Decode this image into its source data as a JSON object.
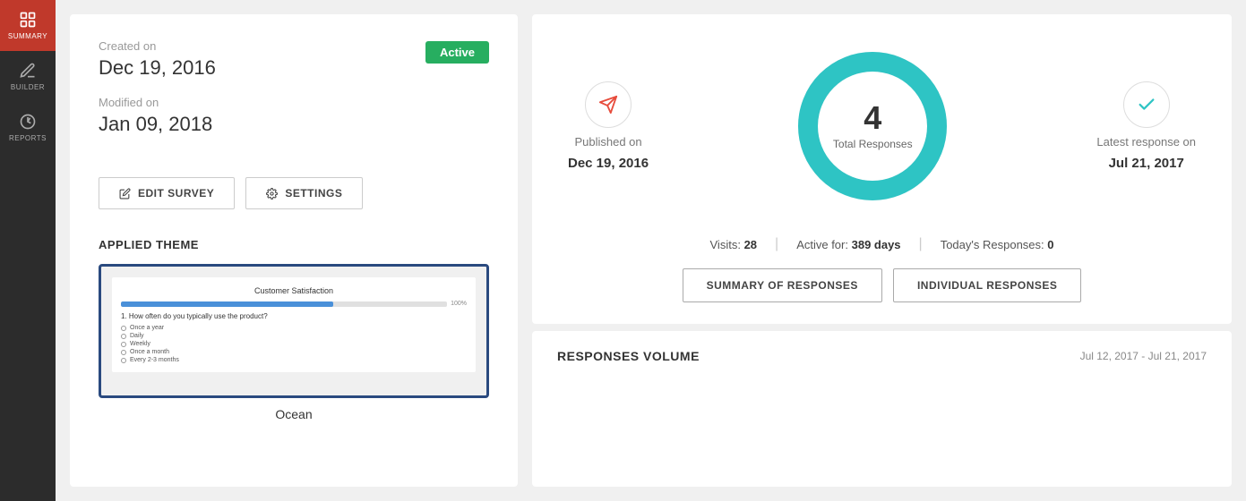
{
  "sidebar": {
    "items": [
      {
        "id": "summary",
        "label": "Summary",
        "active": true
      },
      {
        "id": "builder",
        "label": "Builder",
        "active": false
      },
      {
        "id": "reports",
        "label": "Reports",
        "active": false
      }
    ]
  },
  "left_panel": {
    "created_label": "Created on",
    "created_date": "Dec 19, 2016",
    "modified_label": "Modified on",
    "modified_date": "Jan 09, 2018",
    "status_badge": "Active",
    "edit_survey_label": "EDIT SURVEY",
    "settings_label": "SETTINGS",
    "applied_theme_label": "APPLIED THEME",
    "theme_preview_title": "Customer Satisfaction",
    "theme_name": "Ocean",
    "theme_bar_label": "100%"
  },
  "right_panel": {
    "published_label": "Published on",
    "published_date": "Dec 19, 2016",
    "total_responses_number": "4",
    "total_responses_label": "Total Responses",
    "latest_response_label": "Latest response on",
    "latest_response_date": "Jul 21, 2017",
    "visits_label": "Visits:",
    "visits_value": "28",
    "active_for_label": "Active for:",
    "active_for_value": "389 days",
    "today_responses_label": "Today's Responses:",
    "today_responses_value": "0",
    "summary_of_responses_label": "SUMMARY OF RESPONSES",
    "individual_responses_label": "INDIVIDUAL RESPONSES",
    "responses_volume_title": "RESPONSES VOLUME",
    "responses_volume_date": "Jul 12, 2017 - Jul 21, 2017"
  },
  "colors": {
    "sidebar_bg": "#2c2c2c",
    "active_nav": "#c0392b",
    "active_badge": "#27ae60",
    "donut_fill": "#2ec4c4",
    "donut_bg": "#e8e8e8"
  }
}
